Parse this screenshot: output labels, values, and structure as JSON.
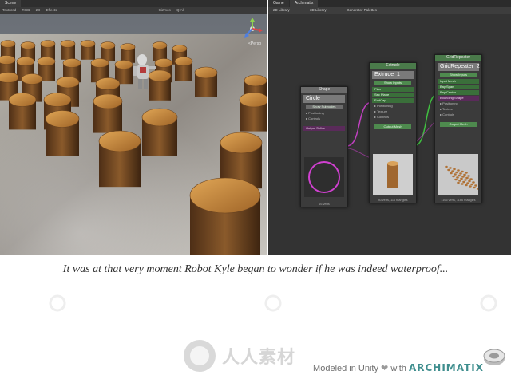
{
  "scene": {
    "tab": "Scene",
    "toolbar": [
      "Textured",
      "RGB",
      "2D",
      "Effects",
      "Gizmos",
      "Q All"
    ],
    "persp_label": "<Persp"
  },
  "graph": {
    "tab": "Game",
    "tab2": "Archimatix",
    "libraries": [
      "2D Library",
      "3D Library",
      "Generator Palettes"
    ],
    "nodes": {
      "shape": {
        "header": "Shape",
        "name": "Circle",
        "button": "Show Subnodes",
        "rows": [
          "Positioning",
          "Controls"
        ],
        "output": "Output Spline",
        "footer": "16 verts"
      },
      "extrude": {
        "header": "Extrude",
        "name": "Extrude_1",
        "button": "Show Inputs",
        "inputs": [
          "Plan",
          "Sec Plane",
          "EndCap"
        ],
        "rows": [
          "Positioning",
          "Texture",
          "Controls"
        ],
        "output": "Output Mesh",
        "footer": "80 verts, 116 triangles"
      },
      "grid": {
        "header": "GridRepeater",
        "name": "GridRepeater_2",
        "button": "Show Inputs",
        "inputs": [
          "Input Mesh",
          "Bay Span",
          "Bay Center",
          "Bounding Shape"
        ],
        "rows": [
          "Positioning",
          "Texture",
          "Controls"
        ],
        "output": "Output Mesh",
        "footer": "1166 verts, 1166 triangles"
      }
    }
  },
  "caption": "It was at that very moment Robot Kyle began to wonder if he was indeed waterproof...",
  "watermark": "人人素材",
  "credit": {
    "prefix": "Modeled in Unity",
    "with": "with",
    "brand": "ARCHIMATIX"
  },
  "colors": {
    "node_green": "#4e8a4e",
    "wire_purple": "#c040c0",
    "wire_green": "#40c040",
    "brand_teal": "#3f8e8e"
  }
}
